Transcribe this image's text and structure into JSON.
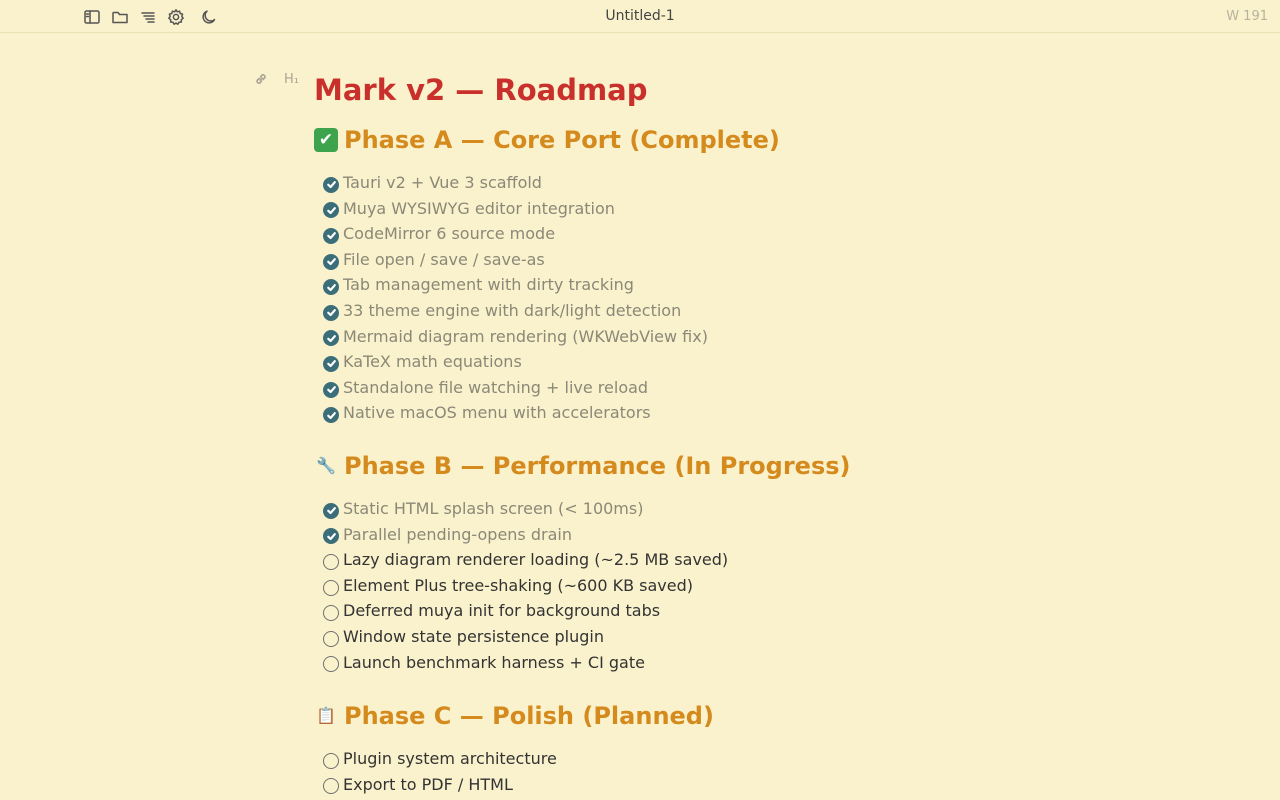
{
  "titlebar": {
    "document_title": "Untitled-1",
    "word_count": "W 191",
    "icons": [
      "sidebar-toggle-icon",
      "folder-icon",
      "outline-icon",
      "gear-icon",
      "moon-icon"
    ]
  },
  "gutter": {
    "link_icon": "link-icon",
    "heading_marker": "H₁"
  },
  "document": {
    "title": "Mark v2 — Roadmap",
    "sections": [
      {
        "emoji": "✔",
        "heading": "Phase A — Core Port (Complete)",
        "tasks": [
          {
            "text": "Tauri v2 + Vue 3 scaffold",
            "done": true
          },
          {
            "text": "Muya WYSIWYG editor integration",
            "done": true
          },
          {
            "text": "CodeMirror 6 source mode",
            "done": true
          },
          {
            "text": "File open / save / save-as",
            "done": true
          },
          {
            "text": "Tab management with dirty tracking",
            "done": true
          },
          {
            "text": "33 theme engine with dark/light detection",
            "done": true
          },
          {
            "text": "Mermaid diagram rendering (WKWebView fix)",
            "done": true
          },
          {
            "text": "KaTeX math equations",
            "done": true
          },
          {
            "text": "Standalone file watching + live reload",
            "done": true
          },
          {
            "text": "Native macOS menu with accelerators",
            "done": true
          }
        ]
      },
      {
        "emoji": "🔧",
        "heading": "Phase B — Performance (In Progress)",
        "tasks": [
          {
            "text": "Static HTML splash screen (< 100ms)",
            "done": true
          },
          {
            "text": "Parallel pending-opens drain",
            "done": true
          },
          {
            "text": "Lazy diagram renderer loading (~2.5 MB saved)",
            "done": false
          },
          {
            "text": "Element Plus tree-shaking (~600 KB saved)",
            "done": false
          },
          {
            "text": "Deferred muya init for background tabs",
            "done": false
          },
          {
            "text": "Window state persistence plugin",
            "done": false
          },
          {
            "text": "Launch benchmark harness + CI gate",
            "done": false
          }
        ]
      },
      {
        "emoji": "📋",
        "heading": "Phase C — Polish (Planned)",
        "tasks": [
          {
            "text": "Plugin system architecture",
            "done": false
          },
          {
            "text": "Export to PDF / HTML",
            "done": false
          }
        ]
      }
    ]
  },
  "colors": {
    "background": "#faf2cc",
    "h1": "#c9302c",
    "h2": "#d58a1e",
    "checkbox_done": "#3c6e7a",
    "text_done": "#8b8878",
    "text_todo": "#333333"
  }
}
